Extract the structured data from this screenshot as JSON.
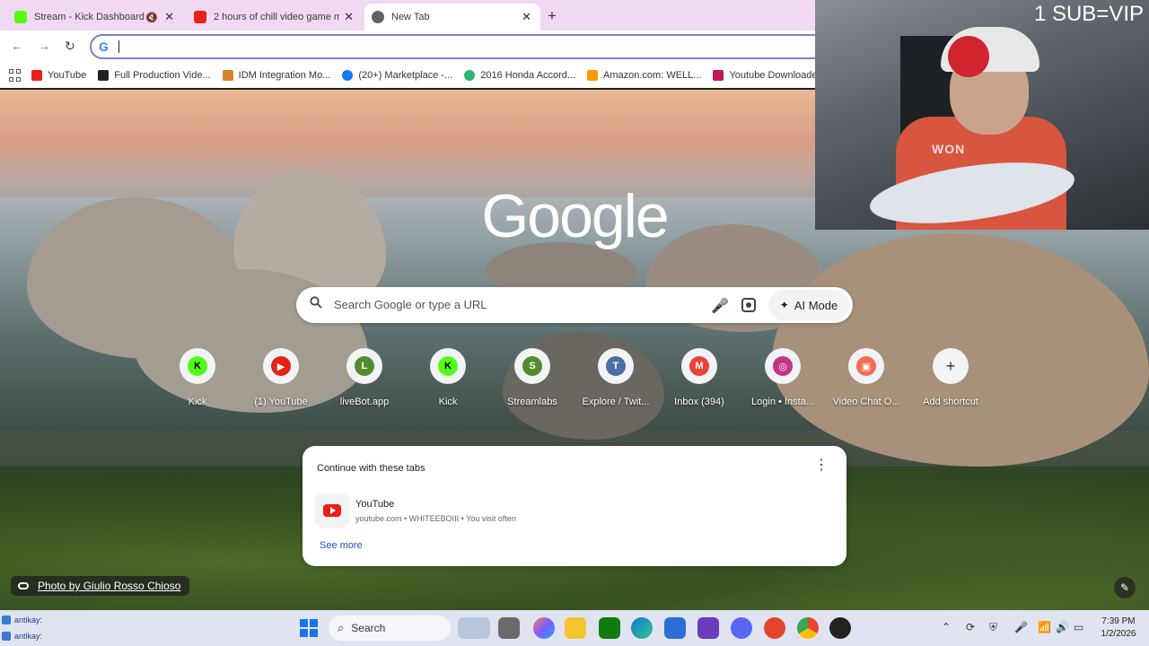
{
  "tabs": [
    {
      "title": "Stream - Kick Dashboard",
      "favicon": "kick-icon",
      "color": "#53fc18",
      "muted": true
    },
    {
      "title": "2 hours of chill video game mu",
      "favicon": "youtube-icon",
      "color": "#e62117"
    },
    {
      "title": "New Tab",
      "favicon": "chrome-icon",
      "color": "#5f6368",
      "active": true
    }
  ],
  "omnibox": {
    "value": ""
  },
  "bookmarks": [
    {
      "label": "YouTube",
      "color": "#e62117"
    },
    {
      "label": "Full Production Vide...",
      "color": "#222222"
    },
    {
      "label": "IDM Integration Mo...",
      "color": "#d9822b"
    },
    {
      "label": "(20+) Marketplace -...",
      "color": "#1877f2"
    },
    {
      "label": "2016 Honda Accord...",
      "color": "#2bb673"
    },
    {
      "label": "Amazon.com: WELL...",
      "color": "#ff9900"
    },
    {
      "label": "Youtube Downloade...",
      "color": "#c2185b"
    }
  ],
  "webcam": {
    "overlay_text": "1 SUB=VIP",
    "shirt_text": "WON"
  },
  "google_logo": "Google",
  "search": {
    "placeholder": "Search Google or type a URL",
    "ai_mode": "AI Mode"
  },
  "shortcuts": [
    {
      "label": "Kick",
      "letter": "K",
      "color": "#53fc18",
      "text_color": "#000000"
    },
    {
      "label": "(1) YouTube",
      "letter": "▶",
      "color": "#e62117",
      "text_color": "#ffffff"
    },
    {
      "label": "liveBot.app",
      "letter": "L",
      "color": "#558b2f",
      "text_color": "#ffffff"
    },
    {
      "label": "Kick",
      "letter": "K",
      "color": "#53fc18",
      "text_color": "#000000"
    },
    {
      "label": "Streamlabs",
      "letter": "S",
      "color": "#558b2f",
      "text_color": "#ffffff"
    },
    {
      "label": "Explore / Twit...",
      "letter": "T",
      "color": "#4a6fa5",
      "text_color": "#ffffff"
    },
    {
      "label": "Inbox (394)",
      "letter": "M",
      "color": "#ea4335",
      "text_color": "#ffffff"
    },
    {
      "label": "Login • Insta...",
      "letter": "◎",
      "color": "#c13584",
      "text_color": "#ffffff"
    },
    {
      "label": "Video Chat O...",
      "letter": "▣",
      "color": "#f26d50",
      "text_color": "#ffffff"
    },
    {
      "label": "Add shortcut",
      "letter": "+",
      "color": "#f1f3f4",
      "text_color": "#333333"
    }
  ],
  "continue_card": {
    "title": "Continue with these tabs",
    "item": {
      "title": "YouTube",
      "subtitle": "youtube.com • WHITEEBOIII • You visit often"
    },
    "see_more": "See more"
  },
  "photo_credit": "Photo by Giulio Rosso Chioso",
  "taskbar": {
    "chat_items": [
      "antikay:",
      "antikay:"
    ],
    "search_label": "Search",
    "time": "7:39 PM",
    "date": "1/2/2026"
  }
}
